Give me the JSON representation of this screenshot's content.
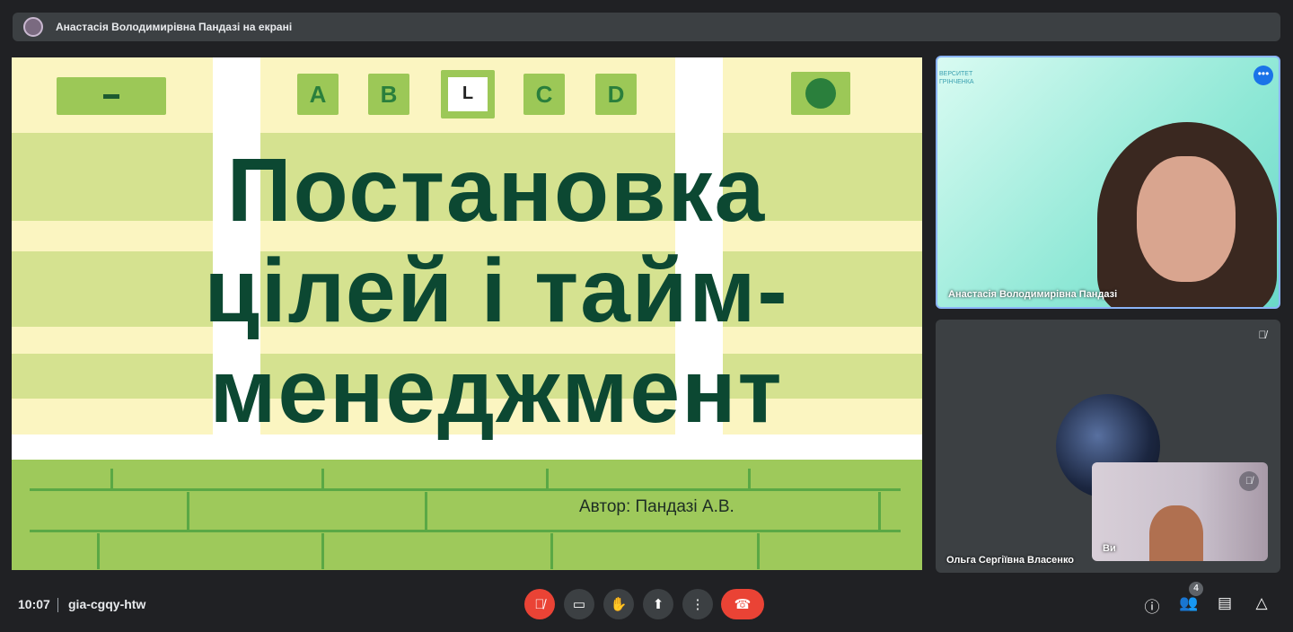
{
  "topbar": {
    "presenting_label": "Анастасія Володимирівна Пандазі на екрані"
  },
  "slide": {
    "title_line1": "Постановка",
    "title_line2": "цілей і тайм-",
    "title_line3": "менеджмент",
    "author": "Автор: Пандазі А.В.",
    "tiles": [
      "A",
      "B",
      "C",
      "D"
    ]
  },
  "participants": [
    {
      "name": "Анастасія Володимирівна Пандазі",
      "logo_line1": "ВЕРСИТЕТ",
      "logo_line2": "ГРІНЧЕНКА"
    },
    {
      "name": "Ольга Сергіївна Власенко"
    },
    {
      "name": "Ви"
    }
  ],
  "bottom": {
    "time": "10:07",
    "meeting_code": "gia-cgqy-htw",
    "participants_count": "4"
  },
  "colors": {
    "accent": "#1a73e8",
    "danger": "#ea4335",
    "slide_title": "#0c4832"
  }
}
